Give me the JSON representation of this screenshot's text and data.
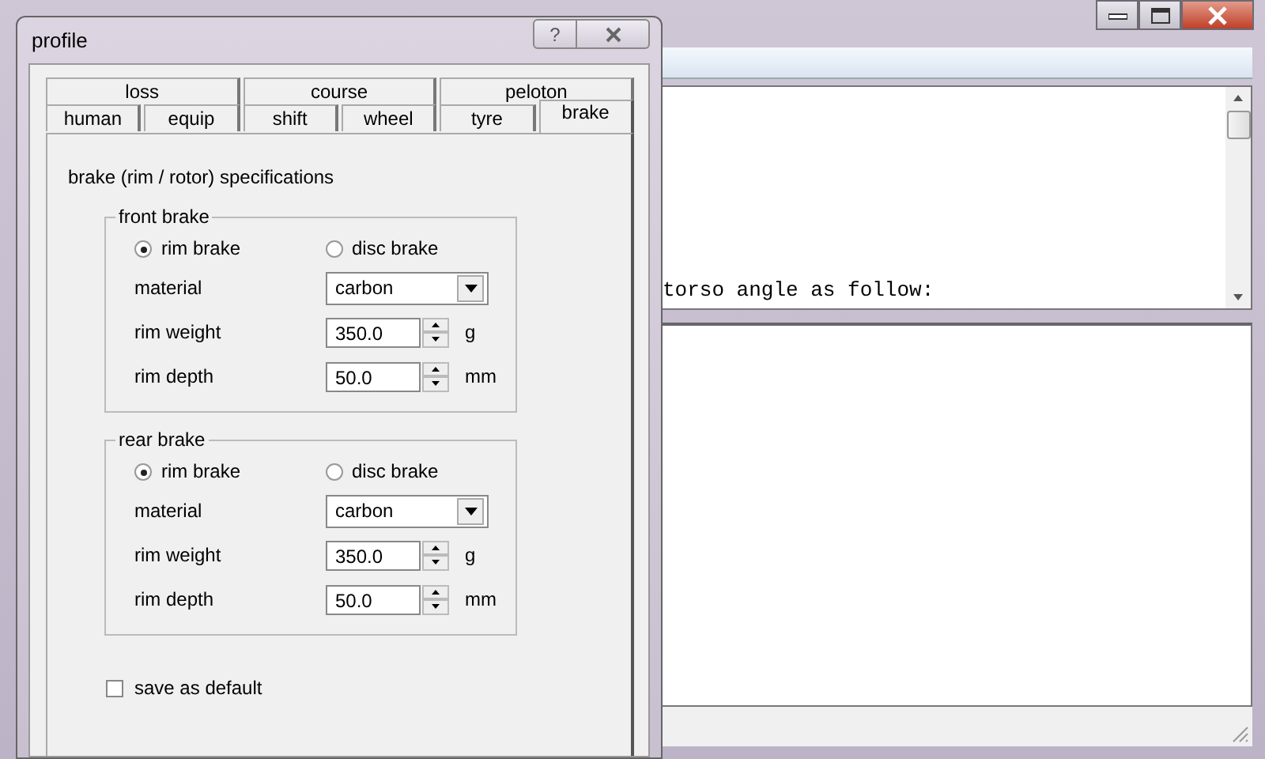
{
  "main_window": {
    "upper_pane_text": "torso angle as follow:"
  },
  "dialog": {
    "title": "profile",
    "help_button": "?"
  },
  "tab_rows": [
    [
      {
        "label": "loss",
        "selected": false
      },
      {
        "label": "course",
        "selected": false
      },
      {
        "label": "peloton",
        "selected": false
      }
    ],
    [
      {
        "label": "human",
        "selected": false
      },
      {
        "label": "equip",
        "selected": false
      },
      {
        "label": "shift",
        "selected": false
      },
      {
        "label": "wheel",
        "selected": false
      },
      {
        "label": "tyre",
        "selected": false
      },
      {
        "label": "brake",
        "selected": true
      }
    ]
  ],
  "heading": "brake (rim / rotor) specifications",
  "groups": [
    {
      "title": "front brake",
      "options": [
        {
          "label": "rim brake",
          "selected": true
        },
        {
          "label": "disc brake",
          "selected": false
        }
      ],
      "fields": [
        {
          "kind": "dropdown",
          "label": "material",
          "value": "carbon"
        },
        {
          "kind": "spin",
          "label": "rim weight",
          "value": "350.0",
          "unit": "g"
        },
        {
          "kind": "spin",
          "label": "rim depth",
          "value": "50.0",
          "unit": "mm"
        }
      ]
    },
    {
      "title": "rear brake",
      "options": [
        {
          "label": "rim brake",
          "selected": true
        },
        {
          "label": "disc brake",
          "selected": false
        }
      ],
      "fields": [
        {
          "kind": "dropdown",
          "label": "material",
          "value": "carbon"
        },
        {
          "kind": "spin",
          "label": "rim weight",
          "value": "350.0",
          "unit": "g"
        },
        {
          "kind": "spin",
          "label": "rim depth",
          "value": "50.0",
          "unit": "mm"
        }
      ]
    }
  ],
  "save_default": {
    "label": "save as default",
    "checked": false
  }
}
